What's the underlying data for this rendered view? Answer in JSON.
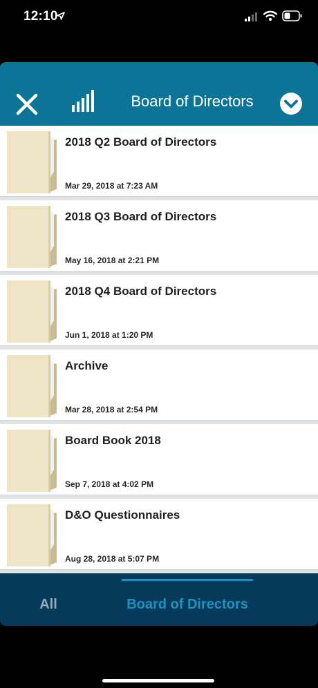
{
  "status_bar": {
    "time": "12:10"
  },
  "header": {
    "title": "Board of Directors"
  },
  "items": [
    {
      "title": "2018 Q2 Board of Directors",
      "date": "Mar 29, 2018 at 7:23 AM"
    },
    {
      "title": "2018 Q3 Board of Directors",
      "date": "May 16, 2018 at 2:21 PM"
    },
    {
      "title": "2018 Q4 Board of Directors",
      "date": "Jun 1, 2018 at 1:20 PM"
    },
    {
      "title": "Archive",
      "date": "Mar 28, 2018 at 2:54 PM"
    },
    {
      "title": "Board Book 2018",
      "date": "Sep 7, 2018 at 4:02 PM"
    },
    {
      "title": "D&O Questionnaires",
      "date": "Aug 28, 2018 at 5:07 PM"
    }
  ],
  "tabs": [
    {
      "label": "All"
    },
    {
      "label": "Board of Directors"
    }
  ],
  "colors": {
    "header": "#0c7496",
    "tab_bar": "#053a5a",
    "active_tab": "#1e93bd"
  },
  "icons": [
    "close-icon",
    "signal-bars-icon",
    "chevron-down-icon",
    "folder-icon"
  ]
}
